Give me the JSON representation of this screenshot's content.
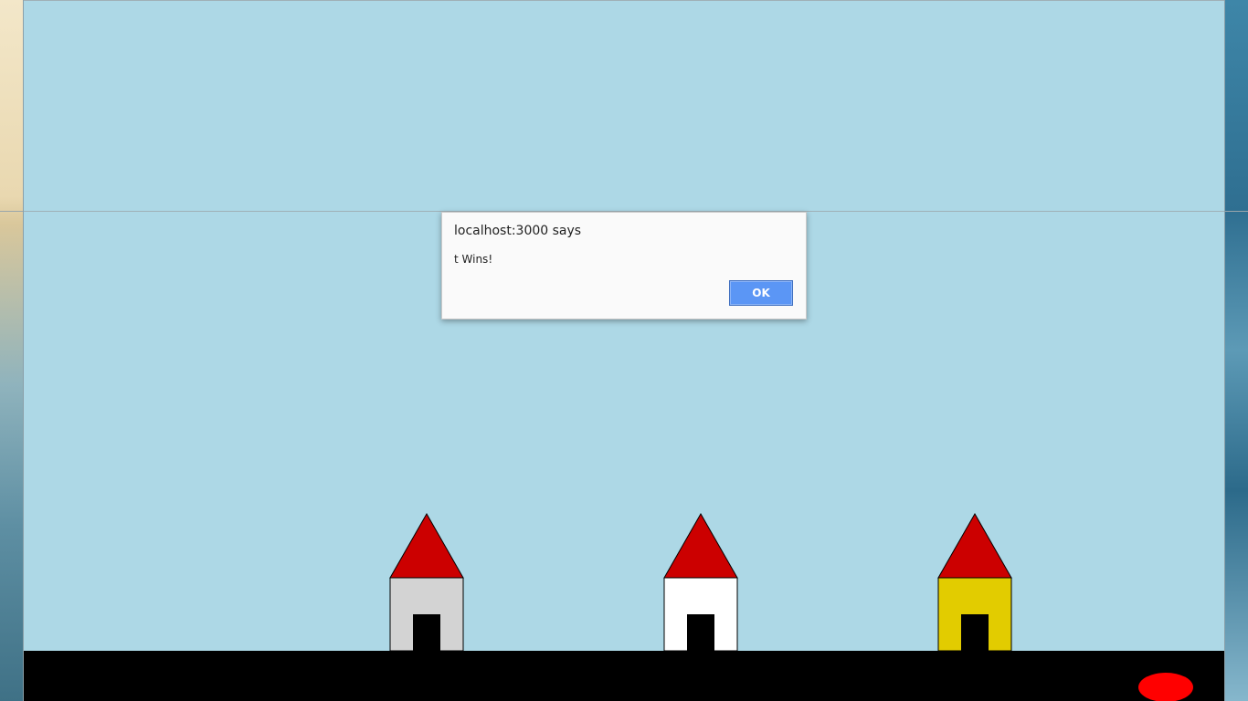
{
  "alert": {
    "title": "localhost:3000 says",
    "message": "t Wins!",
    "ok_label": "OK"
  },
  "game": {
    "sky_color": "#add8e6",
    "ground_color": "#000000",
    "ball_color": "#ff0000",
    "roof_color": "#cc0000",
    "door_color": "#000000",
    "houses": [
      {
        "name": "gray",
        "wall_color": "#d3d3d3"
      },
      {
        "name": "white",
        "wall_color": "#ffffff"
      },
      {
        "name": "yellow",
        "wall_color": "#e2cc00"
      }
    ]
  }
}
